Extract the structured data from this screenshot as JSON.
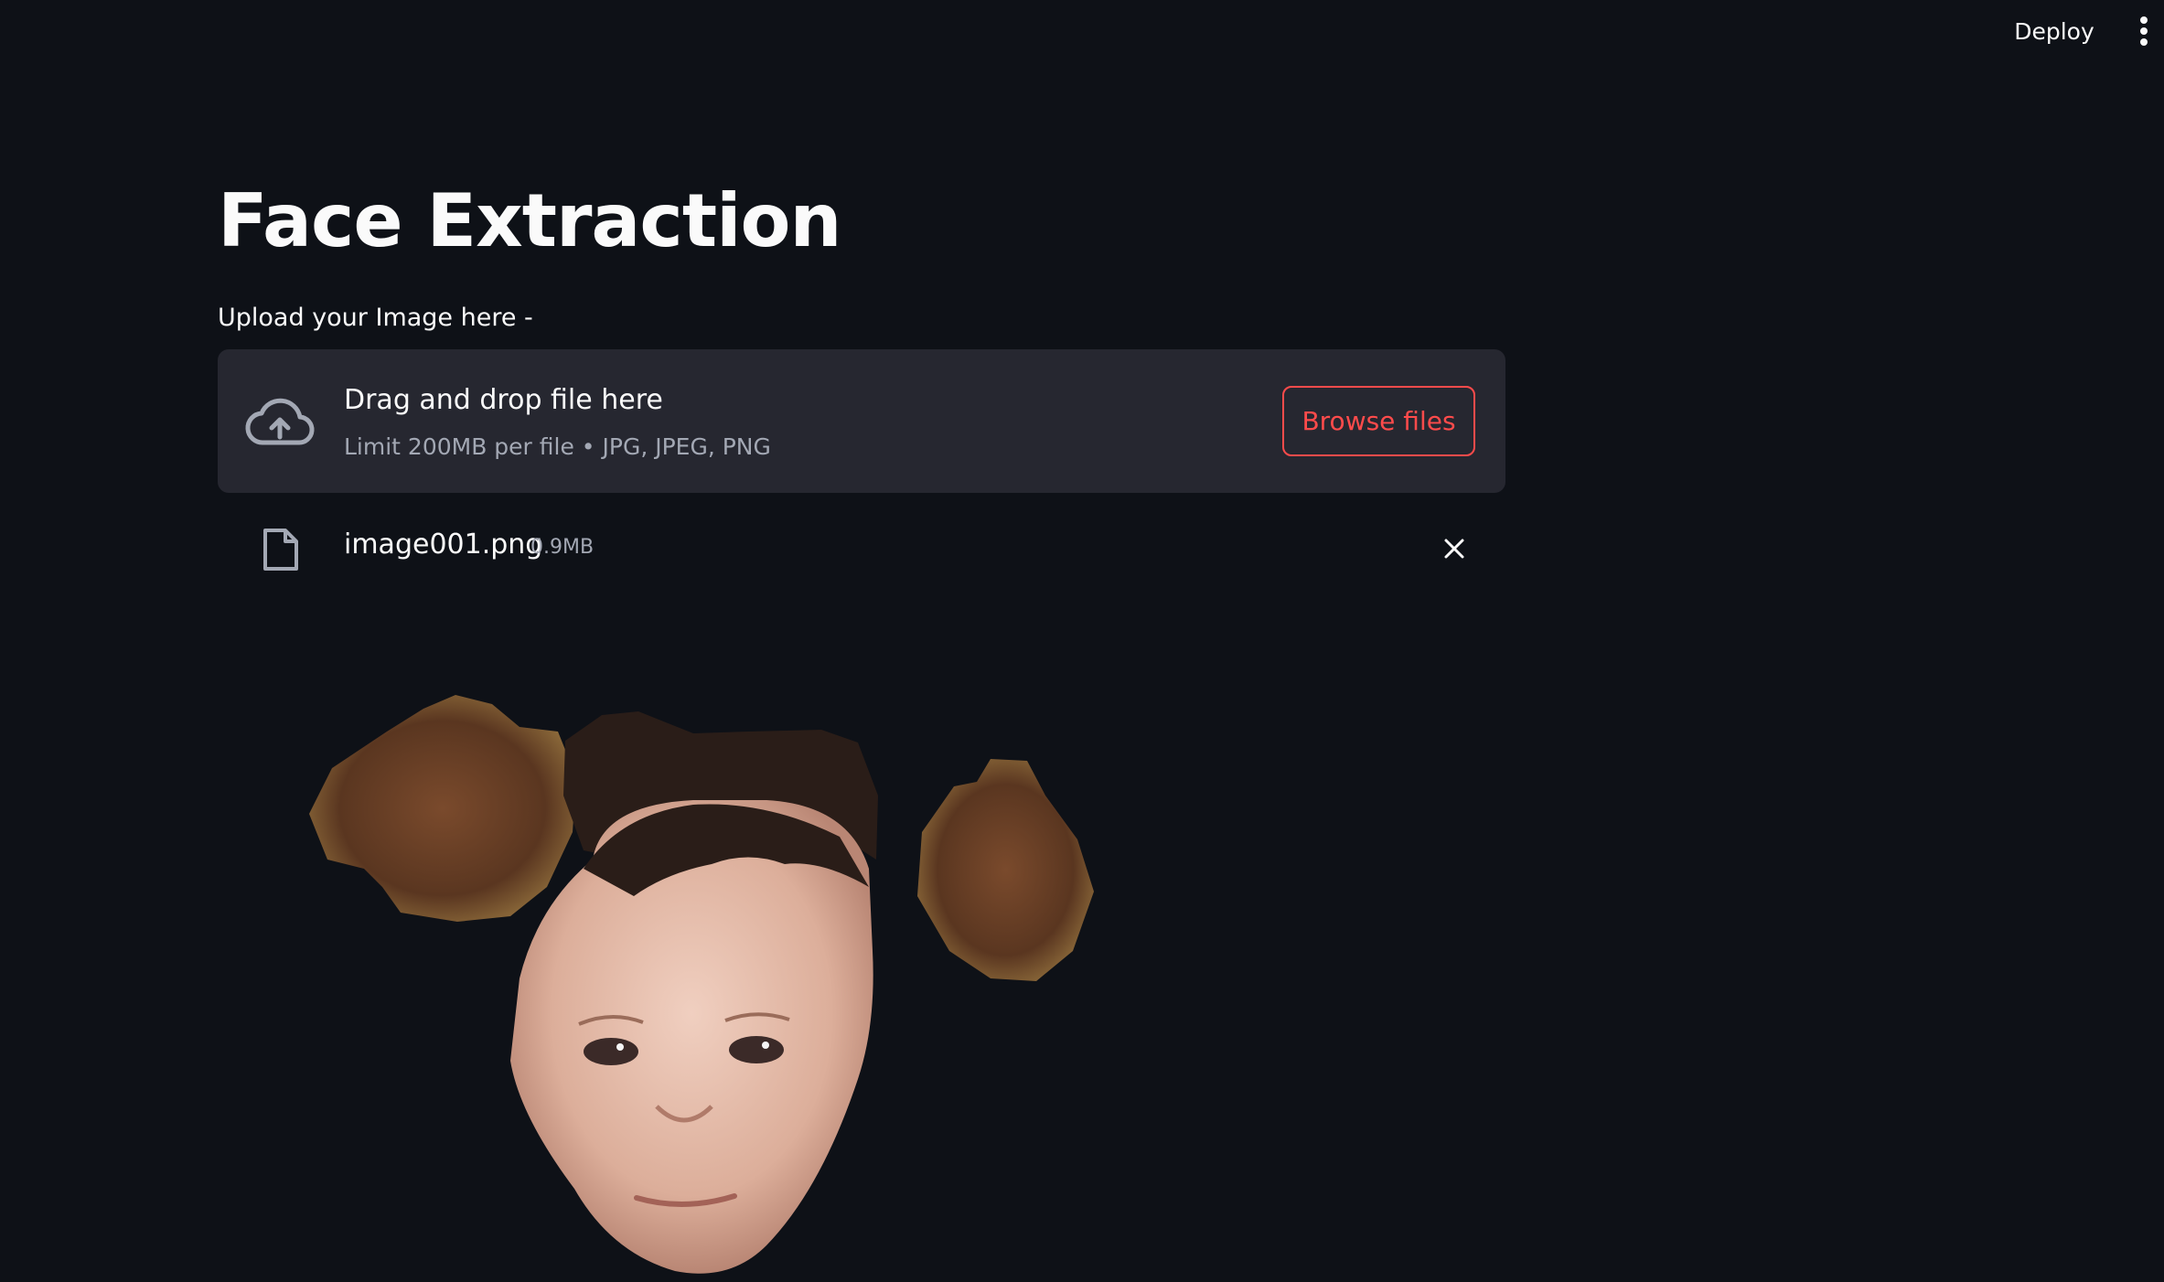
{
  "header": {
    "deploy_label": "Deploy",
    "menu_icon": "vertical-dots-icon"
  },
  "main": {
    "title": "Face Extraction",
    "upload_label": "Upload your Image here -"
  },
  "uploader": {
    "icon": "cloud-upload-icon",
    "title": "Drag and drop file here",
    "subtitle": "Limit 200MB per file • JPG, JPEG, PNG",
    "browse_label": "Browse files",
    "accent_color": "#ff4b4b"
  },
  "uploaded_file": {
    "icon": "file-icon",
    "name": "image001.png",
    "size": "0.9MB",
    "remove_icon": "close-icon"
  },
  "result": {
    "image": "extracted-face-image"
  }
}
